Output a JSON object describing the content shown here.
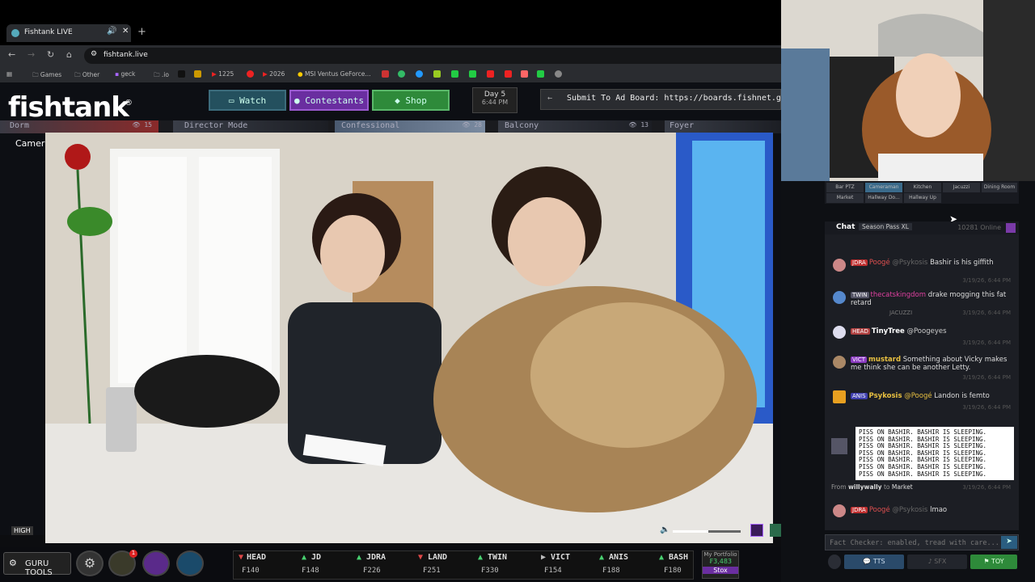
{
  "browser": {
    "tab_title": "Fishtank LIVE",
    "url": "fishtank.live",
    "bookmarks": [
      "Games",
      "Other",
      "geck",
      ".io",
      "1225",
      "2026",
      "MSI Ventus GeForce..."
    ]
  },
  "site": {
    "logo": "fishtank",
    "nav": {
      "watch": "Watch",
      "contestants": "Contestants",
      "shop": "Shop"
    },
    "day": "Day 5",
    "time": "6:44 PM",
    "ad_board": "Submit To Ad Board: https://boards.fishnet.gg/",
    "camera_tabs": [
      {
        "label": "Dorm",
        "count": "15"
      },
      {
        "label": "Director Mode",
        "count": ""
      },
      {
        "label": "Confessional",
        "count": "28"
      },
      {
        "label": "Balcony",
        "count": "13"
      },
      {
        "label": "Foyer",
        "count": ""
      }
    ],
    "current_camera": "Cameraman",
    "quality": "HIGH"
  },
  "bottom": {
    "guru_tools": "GURU TOOLS",
    "notif_count": "1",
    "stocks": [
      {
        "dir": "down",
        "name": "HEAD",
        "value": "₣140",
        "color": "#e04848"
      },
      {
        "dir": "up",
        "name": "JD",
        "value": "₣148",
        "color": "#48d070"
      },
      {
        "dir": "up",
        "name": "JDRA",
        "value": "₣226",
        "color": "#48d070"
      },
      {
        "dir": "down",
        "name": "LAND",
        "value": "₣251",
        "color": "#e04848"
      },
      {
        "dir": "up",
        "name": "TWIN",
        "value": "₣330",
        "color": "#48d070"
      },
      {
        "dir": "flat",
        "name": "VICT",
        "value": "₣154",
        "color": "#bbbbbb"
      },
      {
        "dir": "up",
        "name": "ANIS",
        "value": "₣188",
        "color": "#48d070"
      },
      {
        "dir": "up",
        "name": "BASH",
        "value": "₣180",
        "color": "#48d070"
      }
    ],
    "portfolio": {
      "label": "My Portfolio",
      "value": "₣3,483",
      "button": "Stox"
    }
  },
  "right_panel": {
    "rooms": [
      "Bar PTZ",
      "Cameraman",
      "Kitchen",
      "Jacuzzi",
      "Dining Room",
      "Market",
      "Hallway Do...",
      "Hallway Up"
    ],
    "chat": {
      "tab": "Chat",
      "season_pass": "Season Pass XL",
      "online": "10281 Online",
      "messages": [
        {
          "badge": "JDRA",
          "badge_color": "#c03030",
          "user": "Poogé",
          "user_color": "#e05050",
          "mention": "@Psykosis",
          "text": "Bashir is his giffith",
          "time": "3/19/26, 6:44 PM"
        },
        {
          "badge": "TWIN",
          "badge_color": "#555566",
          "user": "thecatskingdom",
          "user_color": "#e040a0",
          "mention": "",
          "text": "drake mogging this fat retard",
          "time": "3/19/26, 6:44 PM"
        },
        {
          "badge": "HEAD",
          "badge_color": "#b04040",
          "user": "TinyTree",
          "user_color": "#ffffff",
          "mention": "@Poogeyes",
          "text": "",
          "time": "3/19/26, 6:44 PM"
        },
        {
          "badge": "VICT",
          "badge_color": "#8a3ac0",
          "user": "mustard",
          "user_color": "#e8c040",
          "mention": "",
          "text": "Something about Vicky makes me think she can be another Letty.",
          "time": "3/19/26, 6:44 PM"
        },
        {
          "badge": "ANIS",
          "badge_color": "#4040b0",
          "user": "Psykosis",
          "user_color": "#e8c040",
          "mention": "@Poogé",
          "text": "Landon is femto",
          "time": "3/19/26, 6:44 PM"
        }
      ],
      "system_label": "JACUZZI",
      "tts_message": {
        "lines": [
          "PISS ON BASHIR. BASHIR IS SLEEPING.",
          "PISS ON BASHIR. BASHIR IS SLEEPING.",
          "PISS ON BASHIR. BASHIR IS SLEEPING.",
          "PISS ON BASHIR. BASHIR IS SLEEPING.",
          "PISS ON BASHIR. BASHIR IS SLEEPING.",
          "PISS ON BASHIR. BASHIR IS SLEEPING.",
          "PISS ON BASHIR. BASHIR IS SLEEPING."
        ],
        "from_label": "From",
        "from_user": "willywally",
        "to_label": "to",
        "to_room": "Market",
        "time": "3/19/26, 6:44 PM"
      },
      "last": {
        "badge": "JDRA",
        "badge_color": "#c03030",
        "user": "Poogé",
        "user_color": "#e05050",
        "mention": "@Psykosis",
        "text": "lmao"
      },
      "input_placeholder": "Fact Checker: enabled, tread with care...",
      "footer": {
        "tts": "TTS",
        "sfx": "SFX",
        "toy": "TOY"
      }
    }
  },
  "colors": {
    "accent_teal": "#3c6c7c",
    "contestants_purple": "#8a3ac8",
    "shop_green": "#2e8a3a"
  }
}
